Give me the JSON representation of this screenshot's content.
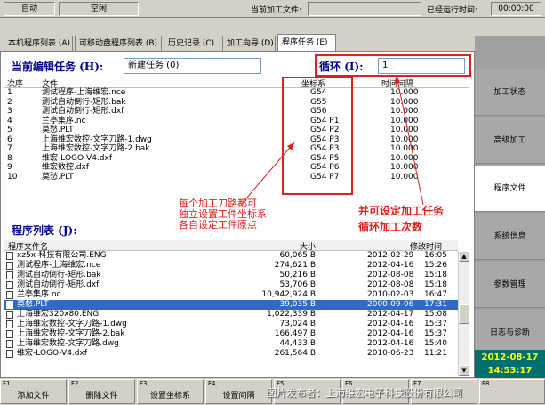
{
  "topbar": {
    "mode": "自动",
    "state": "空闲",
    "current_file_label": "当前加工文件:",
    "current_file_value": "",
    "runtime_label": "已经运行时间:",
    "runtime_value": "00:00:00"
  },
  "tabs": [
    {
      "label": "本机程序列表 (A)"
    },
    {
      "label": "可移动盘程序列表 (B)"
    },
    {
      "label": "历史记录 (C)"
    },
    {
      "label": "加工向导 (D)"
    },
    {
      "label": "程序任务 (E)"
    }
  ],
  "edit": {
    "title": "当前编辑任务 (H):",
    "value": "新建任务 (0)",
    "loop_title": "循环 (I):",
    "loop_value": "1"
  },
  "task_table": {
    "headers": [
      "次序",
      "文件",
      "坐标系",
      "时间间隔"
    ],
    "rows": [
      [
        "1",
        "测试程序-上海维宏.nce",
        "G54",
        "10.000"
      ],
      [
        "2",
        "测试自动倒行-矩形.bak",
        "G55",
        "10.000"
      ],
      [
        "3",
        "测试自动倒行-矩形.dxf",
        "G56",
        "10.000"
      ],
      [
        "4",
        "兰亭集序.nc",
        "G54 P1",
        "10.000"
      ],
      [
        "5",
        "莫愁.PLT",
        "G54 P2",
        "10.000"
      ],
      [
        "6",
        "上海维宏数控-文字刀路-1.dwg",
        "G54 P3",
        "10.000"
      ],
      [
        "7",
        "上海维宏数控-文字刀路-2.bak",
        "G54 P3",
        "10.000"
      ],
      [
        "8",
        "维宏-LOGO-V4.dxf",
        "G54 P5",
        "10.000"
      ],
      [
        "9",
        "维宏数控.dxf",
        "G54 P6",
        "10.000"
      ],
      [
        "10",
        "莫愁.PLT",
        "G54 P7",
        "10.000"
      ]
    ]
  },
  "annotations": {
    "coord_note": [
      "每个加工刀路都可",
      "独立设置工件坐标系",
      "各自设定工件原点"
    ],
    "loop_note": [
      "并可设定加工任务",
      "循环加工次数"
    ]
  },
  "file_list": {
    "title": "程序列表 (J):",
    "headers": [
      "程序文件名",
      "大小",
      "修改时间"
    ],
    "selected_index": 5,
    "rows": [
      [
        "xz5x-科技有限公司.ENG",
        "60,065 B",
        "2012-02-29",
        "16:05"
      ],
      [
        "测试程序-上海维宏.nce",
        "274,621 B",
        "2012-04-16",
        "15:26"
      ],
      [
        "测试自动倒行-矩形.bak",
        "50,216 B",
        "2012-08-08",
        "15:18"
      ],
      [
        "测试自动倒行-矩形.dxf",
        "53,706 B",
        "2012-08-08",
        "15:18"
      ],
      [
        "兰亭集序.nc",
        "10,942,924 B",
        "2010-02-03",
        "16:47"
      ],
      [
        "莫愁.PLT",
        "39,035 B",
        "2000-09-06",
        "17:31"
      ],
      [
        "上海维宏320x80.ENG",
        "1,022,339 B",
        "2012-04-17",
        "15:08"
      ],
      [
        "上海维宏数控-文字刀路-1.dwg",
        "73,024 B",
        "2012-04-16",
        "15:37"
      ],
      [
        "上海维宏数控-文字刀路-2.bak",
        "166,497 B",
        "2012-04-16",
        "15:37"
      ],
      [
        "上海维宏数控-文字刀路.dwg",
        "44,433 B",
        "2012-04-16",
        "15:40"
      ],
      [
        "维宏-LOGO-V4.dxf",
        "261,564 B",
        "2010-06-23",
        "11:21"
      ]
    ]
  },
  "sidebar": {
    "items": [
      {
        "label": "加工状态"
      },
      {
        "label": "高级加工"
      },
      {
        "label": "程序文件"
      },
      {
        "label": "系统信息"
      },
      {
        "label": "参数管理"
      },
      {
        "label": "日志与诊断"
      }
    ],
    "active_index": 2,
    "date": "2012-08-17",
    "time": "14:53:17"
  },
  "fbar": {
    "buttons": [
      {
        "key": "F1",
        "label": "添加文件"
      },
      {
        "key": "F2",
        "label": "删除文件"
      },
      {
        "key": "F3",
        "label": "设置坐标系"
      },
      {
        "key": "F4",
        "label": "设置间隔"
      },
      {
        "key": "F5",
        "label": ""
      },
      {
        "key": "F6",
        "label": ""
      },
      {
        "key": "F7",
        "label": ""
      },
      {
        "key": "F8",
        "label": ""
      }
    ],
    "watermark": "图片发布者：上海维宏电子科技股份有限公司"
  },
  "colors": {
    "title_blue": "#00008b",
    "annotation_red": "#e02020",
    "selection_blue": "#316ac5",
    "clock_bg": "#006f6f",
    "clock_text": "#ffff00"
  }
}
